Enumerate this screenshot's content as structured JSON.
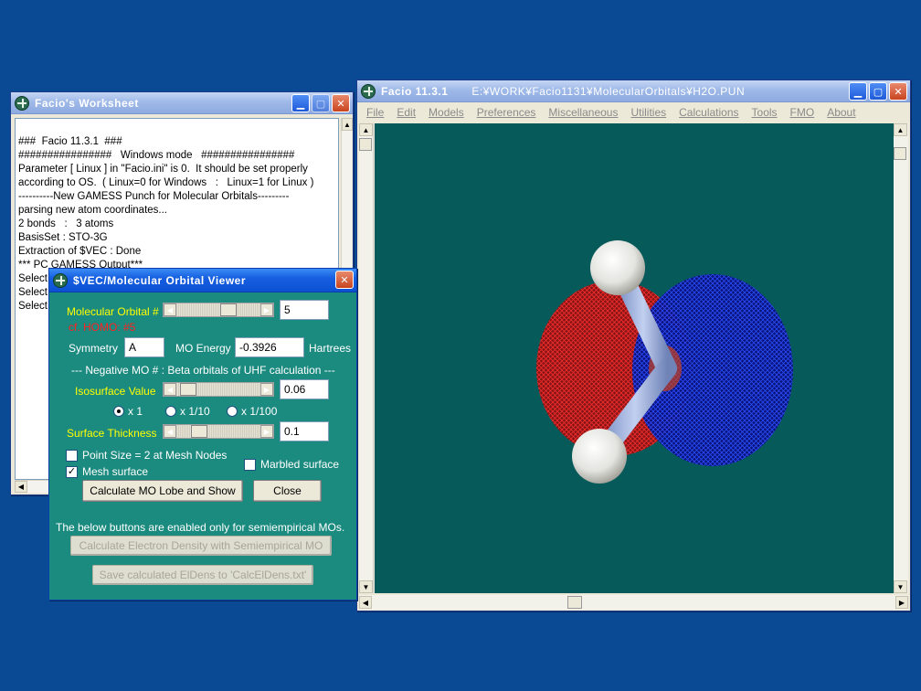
{
  "worksheet": {
    "title": "Facio's Worksheet",
    "lines": [
      "###  Facio 11.3.1  ###",
      "################   Windows mode   ################",
      "Parameter [ Linux ] in \"Facio.ini\" is 0.  It should be set properly",
      "according to OS.  ( Linux=0 for Windows   :   Linux=1 for Linux )",
      "",
      "----------New GAMESS Punch for Molecular Orbitals---------",
      "parsing new atom coordinates...",
      "2 bonds   :   3 atoms",
      "BasisSet : STO-3G",
      "Extraction of $VEC : Done",
      "*** PC GAMESS Output***",
      "Select",
      "Select",
      "Select"
    ]
  },
  "main": {
    "title_app": "Facio  11.3.1",
    "title_path": "E:¥WORK¥Facio1131¥MolecularOrbitals¥H2O.PUN",
    "menu": [
      "File",
      "Edit",
      "Models",
      "Preferences",
      "Miscellaneous",
      "Utilities",
      "Calculations",
      "Tools",
      "FMO",
      "About"
    ]
  },
  "viewer": {
    "title": "$VEC/Molecular Orbital Viewer",
    "mo_label": "Molecular Orbital #",
    "mo_value": "5",
    "homo_label": "cf. HOMO: #5",
    "symmetry_label": "Symmetry",
    "symmetry_value": "A",
    "energy_label": "MO Energy",
    "energy_value": "-0.3926",
    "energy_unit": "Hartrees",
    "negative_note": "--- Negative MO # :  Beta orbitals of UHF calculation ---",
    "iso_label": "Isosurface Value",
    "iso_value": "0.06",
    "scale_options": [
      "x 1",
      "x 1/10",
      "x 1/100"
    ],
    "scale_selected": "x 1",
    "thickness_label": "Surface Thickness",
    "thickness_value": "0.1",
    "point_size_label": "Point Size = 2 at Mesh Nodes",
    "point_size_checked": false,
    "mesh_label": "Mesh surface",
    "mesh_checked": true,
    "marbled_label": "Marbled surface",
    "marbled_checked": false,
    "calc_button": "Calculate MO Lobe and Show",
    "close_button": "Close",
    "semi_note": "The below buttons are enabled only for semiempirical MOs.",
    "density_button": "Calculate Electron Density with Semiempirical MO",
    "save_button": "Save calculated ElDens to 'CalcElDens.txt'"
  },
  "colors": {
    "desktop": "#0a4a94",
    "viewport": "#075a5a",
    "dialog": "#1b8a7f",
    "lobe_positive": "#d11c1c",
    "lobe_negative": "#1432d8"
  }
}
